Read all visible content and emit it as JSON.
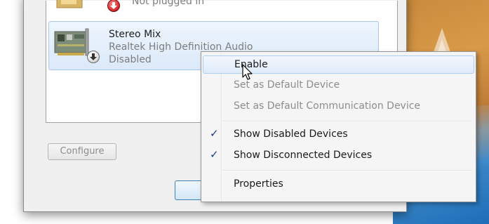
{
  "devices": [
    {
      "name": "",
      "driver": "",
      "status": "Not plugged in"
    },
    {
      "name": "Stereo Mix",
      "driver": "Realtek High Definition Audio",
      "status": "Disabled"
    }
  ],
  "buttons": {
    "configure": "Configure"
  },
  "context_menu": {
    "items": [
      {
        "label": "Enable",
        "enabled": true,
        "checked": false,
        "hovered": true
      },
      {
        "label": "Set as Default Device",
        "enabled": false,
        "checked": false
      },
      {
        "label": "Set as Default Communication Device",
        "enabled": false,
        "checked": false
      },
      {
        "label": "Show Disabled Devices",
        "enabled": true,
        "checked": true
      },
      {
        "label": "Show Disconnected Devices",
        "enabled": true,
        "checked": true
      },
      {
        "label": "Properties",
        "enabled": true,
        "checked": false
      }
    ]
  },
  "icons": {
    "device": "sound-card-icon",
    "disabled_status": "disabled-down-arrow-icon",
    "unplugged_status": "unplugged-red-arrow-icon",
    "check": "checkmark-icon",
    "cursor": "mouse-pointer-icon"
  },
  "colors": {
    "selection_fill": "#dbe9f9",
    "selection_border": "#a8c8ee",
    "check_color": "#1c3a8a",
    "disabled_text": "#8d8d8d"
  }
}
